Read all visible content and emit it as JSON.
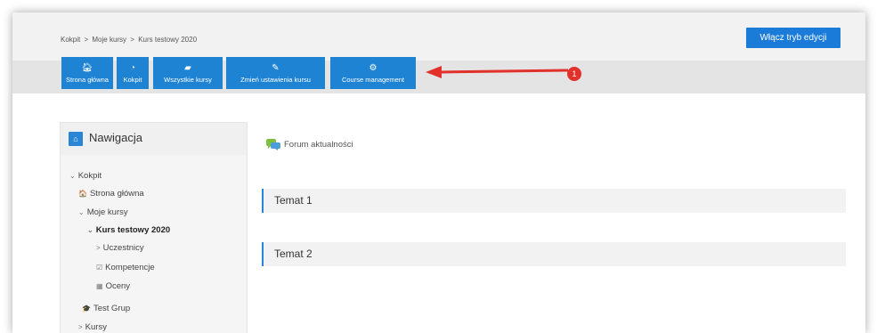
{
  "breadcrumb": [
    "Kokpit",
    "Moje kursy",
    "Kurs testowy 2020"
  ],
  "breadcrumb_sep": ">",
  "edit_button": "Włącz tryb edycji",
  "nav_buttons": [
    {
      "label": "Strona główna",
      "icon": "home-icon"
    },
    {
      "label": "Kokpit",
      "icon": "dashboard-icon"
    },
    {
      "label": "Wszystkie kursy",
      "icon": "book-icon"
    },
    {
      "label": "Zmień ustawienia kursu",
      "icon": "edit-icon"
    },
    {
      "label": "Course management",
      "icon": "cogs-icon"
    }
  ],
  "callout_number": "1",
  "colors": {
    "accent": "#1f83d4",
    "callout": "#e2302b"
  },
  "navigation": {
    "title": "Nawigacja",
    "items": [
      {
        "label": "Kokpit",
        "prefix": "⌄"
      },
      {
        "label": "Strona główna",
        "prefix": "🏠"
      },
      {
        "label": "Moje kursy",
        "prefix": "⌄"
      },
      {
        "label": "Kurs testowy 2020",
        "prefix": "⌄"
      },
      {
        "label": "Uczestnicy",
        "prefix": ">"
      },
      {
        "label": "Kompetencje",
        "prefix": "☑"
      },
      {
        "label": "Oceny",
        "prefix": "▦"
      },
      {
        "label": "Test Grup",
        "prefix": "🎓"
      },
      {
        "label": "Kursy",
        "prefix": ">"
      }
    ]
  },
  "forum": "Forum aktualności",
  "sections": [
    "Temat 1",
    "Temat 2"
  ]
}
